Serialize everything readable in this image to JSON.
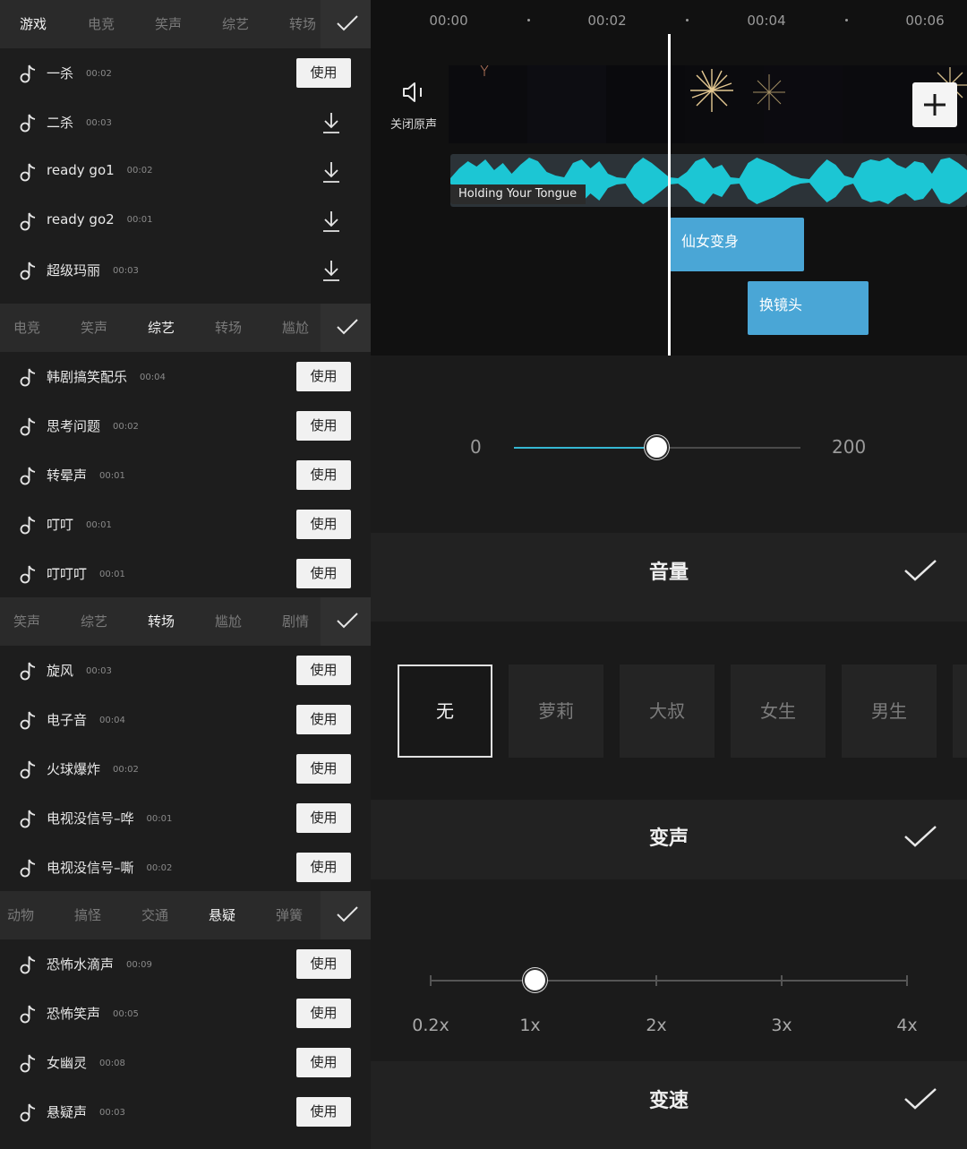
{
  "left": {
    "sections": [
      {
        "tabs": [
          "游戏",
          "电竞",
          "笑声",
          "综艺",
          "转场"
        ],
        "active_tab": 0,
        "items": [
          {
            "name": "一杀",
            "duration": "00:02",
            "action": "使用"
          },
          {
            "name": "二杀",
            "duration": "00:03",
            "action": "download"
          },
          {
            "name": "ready go1",
            "duration": "00:02",
            "action": "download"
          },
          {
            "name": "ready go2",
            "duration": "00:01",
            "action": "download"
          },
          {
            "name": "超级玛丽",
            "duration": "00:03",
            "action": "download"
          }
        ]
      },
      {
        "tabs": [
          "电竞",
          "笑声",
          "综艺",
          "转场",
          "尴尬"
        ],
        "active_tab": 2,
        "items": [
          {
            "name": "韩剧搞笑配乐",
            "duration": "00:04",
            "action": "使用"
          },
          {
            "name": "思考问题",
            "duration": "00:02",
            "action": "使用"
          },
          {
            "name": "转晕声",
            "duration": "00:01",
            "action": "使用"
          },
          {
            "name": "叮叮",
            "duration": "00:01",
            "action": "使用"
          },
          {
            "name": "叮叮叮",
            "duration": "00:01",
            "action": "使用"
          }
        ]
      },
      {
        "tabs": [
          "笑声",
          "综艺",
          "转场",
          "尴尬",
          "剧情"
        ],
        "active_tab": 2,
        "items": [
          {
            "name": "旋风",
            "duration": "00:03",
            "action": "使用"
          },
          {
            "name": "电子音",
            "duration": "00:04",
            "action": "使用"
          },
          {
            "name": "火球爆炸",
            "duration": "00:02",
            "action": "使用"
          },
          {
            "name": "电视没信号–哗",
            "duration": "00:01",
            "action": "使用"
          },
          {
            "name": "电视没信号–嘶",
            "duration": "00:02",
            "action": "使用"
          }
        ]
      },
      {
        "tabs": [
          "动物",
          "搞怪",
          "交通",
          "悬疑",
          "弹簧"
        ],
        "active_tab": 3,
        "items": [
          {
            "name": "恐怖水滴声",
            "duration": "00:09",
            "action": "使用"
          },
          {
            "name": "恐怖笑声",
            "duration": "00:05",
            "action": "使用"
          },
          {
            "name": "女幽灵",
            "duration": "00:08",
            "action": "使用"
          },
          {
            "name": "悬疑声",
            "duration": "00:03",
            "action": "使用"
          }
        ]
      }
    ]
  },
  "timeline": {
    "ruler": [
      "00:00",
      "00:02",
      "00:04",
      "00:06"
    ],
    "mute_label": "关闭原声",
    "audio_title": "Holding Your Tongue",
    "clips": [
      "仙女变身",
      "换镜头"
    ]
  },
  "volume": {
    "min": "0",
    "max": "200",
    "value_fraction": 0.5,
    "title": "音量"
  },
  "voice": {
    "options": [
      "无",
      "萝莉",
      "大叔",
      "女生",
      "男生"
    ],
    "selected": 0,
    "title": "变声"
  },
  "speed": {
    "labels": [
      "0.2x",
      "1x",
      "2x",
      "3x",
      "4x"
    ],
    "selected": 1,
    "title": "变速"
  },
  "colors": {
    "accent": "#35b7d2",
    "waveform": "#1cc6d4",
    "sfx_clip": "#4aa6d6"
  },
  "icons": {
    "note": "music-note-icon",
    "download": "download-icon",
    "confirm": "checkmark-icon",
    "speaker": "speaker-mute-icon",
    "add": "plus-icon"
  }
}
